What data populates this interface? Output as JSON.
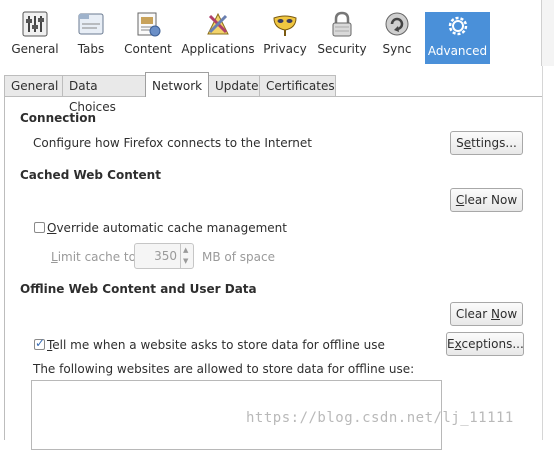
{
  "toolbar": {
    "panes": [
      {
        "label": "General",
        "icon": "sliders-icon"
      },
      {
        "label": "Tabs",
        "icon": "tabs-icon"
      },
      {
        "label": "Content",
        "icon": "content-icon"
      },
      {
        "label": "Applications",
        "icon": "applications-icon"
      },
      {
        "label": "Privacy",
        "icon": "mask-icon"
      },
      {
        "label": "Security",
        "icon": "padlock-icon"
      },
      {
        "label": "Sync",
        "icon": "sync-icon"
      },
      {
        "label": "Advanced",
        "icon": "gear-icon"
      }
    ],
    "active": "Advanced",
    "accent_color": "#4a90d9"
  },
  "subtabs": {
    "items": [
      "General",
      "Data Choices",
      "Network",
      "Update",
      "Certificates"
    ],
    "active": "Network"
  },
  "connection": {
    "heading": "Connection",
    "description": "Configure how Firefox connects to the Internet",
    "settings_button": {
      "pre": "S",
      "u": "e",
      "post": "ttings..."
    }
  },
  "cache": {
    "heading": "Cached Web Content",
    "clear_button": {
      "pre": "",
      "u": "C",
      "post": "lear Now"
    },
    "override": {
      "pre": "",
      "u": "O",
      "post": "verride automatic cache management",
      "checked": false
    },
    "limit": {
      "pre": "",
      "u": "L",
      "post": "imit cache to",
      "value": "350",
      "unit": "MB of space"
    }
  },
  "offline": {
    "heading": "Offline Web Content and User Data",
    "clear_button": {
      "pre": "Clear ",
      "u": "N",
      "post": "ow"
    },
    "tell_me": {
      "pre": "",
      "u": "T",
      "post": "ell me when a website asks to store data for offline use",
      "checked": true
    },
    "exceptions_button": {
      "pre": "E",
      "u": "x",
      "post": "ceptions..."
    },
    "allowed_label": "The following websites are allowed to store data for offline use:"
  },
  "watermark": "https://blog.csdn.net/lj_11111"
}
